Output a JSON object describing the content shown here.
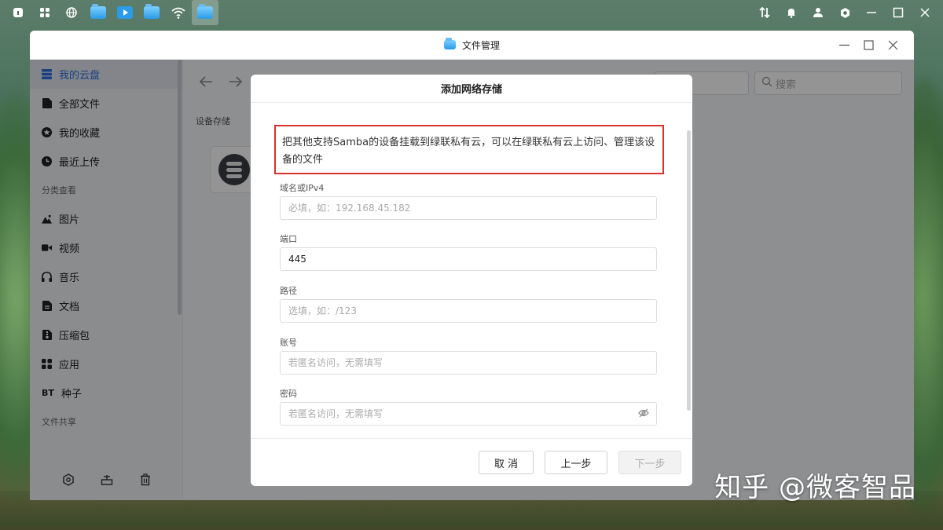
{
  "window": {
    "title": "文件管理"
  },
  "sidebar": {
    "items": [
      {
        "label": "我的云盘",
        "icon": "cloud-disk-icon",
        "active": true
      },
      {
        "label": "全部文件",
        "icon": "file-icon"
      },
      {
        "label": "我的收藏",
        "icon": "star-icon"
      },
      {
        "label": "最近上传",
        "icon": "clock-icon"
      }
    ],
    "section_category": "分类查看",
    "categories": [
      {
        "label": "图片",
        "icon": "image-icon"
      },
      {
        "label": "视频",
        "icon": "video-icon"
      },
      {
        "label": "音乐",
        "icon": "headphones-icon"
      },
      {
        "label": "文档",
        "icon": "document-icon"
      },
      {
        "label": "压缩包",
        "icon": "zip-icon"
      },
      {
        "label": "应用",
        "icon": "apps-icon"
      },
      {
        "label": "种子",
        "icon": "torrent-icon",
        "prefix": "BT"
      }
    ],
    "section_share": "文件共享"
  },
  "main": {
    "section_label": "设备存储",
    "search_placeholder": "搜索"
  },
  "dialog": {
    "title": "添加网络存储",
    "notice": "把其他支持Samba的设备挂载到绿联私有云，可以在绿联私有云上访问、管理该设备的文件",
    "fields": {
      "host": {
        "label": "域名或IPv4",
        "placeholder": "必填，如：192.168.45.182",
        "value": ""
      },
      "port": {
        "label": "端口",
        "placeholder": "",
        "value": "445"
      },
      "path": {
        "label": "路径",
        "placeholder": "选填，如：/123",
        "value": ""
      },
      "account": {
        "label": "账号",
        "placeholder": "若匿名访问，无需填写",
        "value": ""
      },
      "password": {
        "label": "密码",
        "placeholder": "若匿名访问，无需填写",
        "value": ""
      }
    },
    "buttons": {
      "cancel": "取 消",
      "prev": "上一步",
      "next": "下一步"
    }
  },
  "watermark": "知乎 @微客智品",
  "colors": {
    "accent": "#2c6fe0",
    "highlight_border": "#d9312b"
  }
}
